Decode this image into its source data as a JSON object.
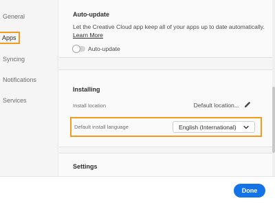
{
  "sidebar": {
    "items": [
      {
        "label": "General",
        "active": false
      },
      {
        "label": "Apps",
        "active": true
      },
      {
        "label": "Syncing",
        "active": false
      },
      {
        "label": "Notifications",
        "active": false
      },
      {
        "label": "Services",
        "active": false
      }
    ]
  },
  "auto_update": {
    "title": "Auto-update",
    "description": "Let the Creative Cloud app keep all of your apps up to date automatically.",
    "learn_more": "Learn More",
    "toggle_label": "Auto-update",
    "toggle_on": false
  },
  "installing": {
    "title": "Installing",
    "location_label": "Install location",
    "location_value": "Default location...",
    "location_icon": "pencil-icon",
    "language_label": "Default install language",
    "language_value": "English (International)",
    "language_icon": "chevron-down-icon"
  },
  "settings": {
    "title": "Settings"
  },
  "footer": {
    "done_label": "Done"
  },
  "colors": {
    "accent": "#1473e6",
    "highlight": "#f29b1d"
  }
}
